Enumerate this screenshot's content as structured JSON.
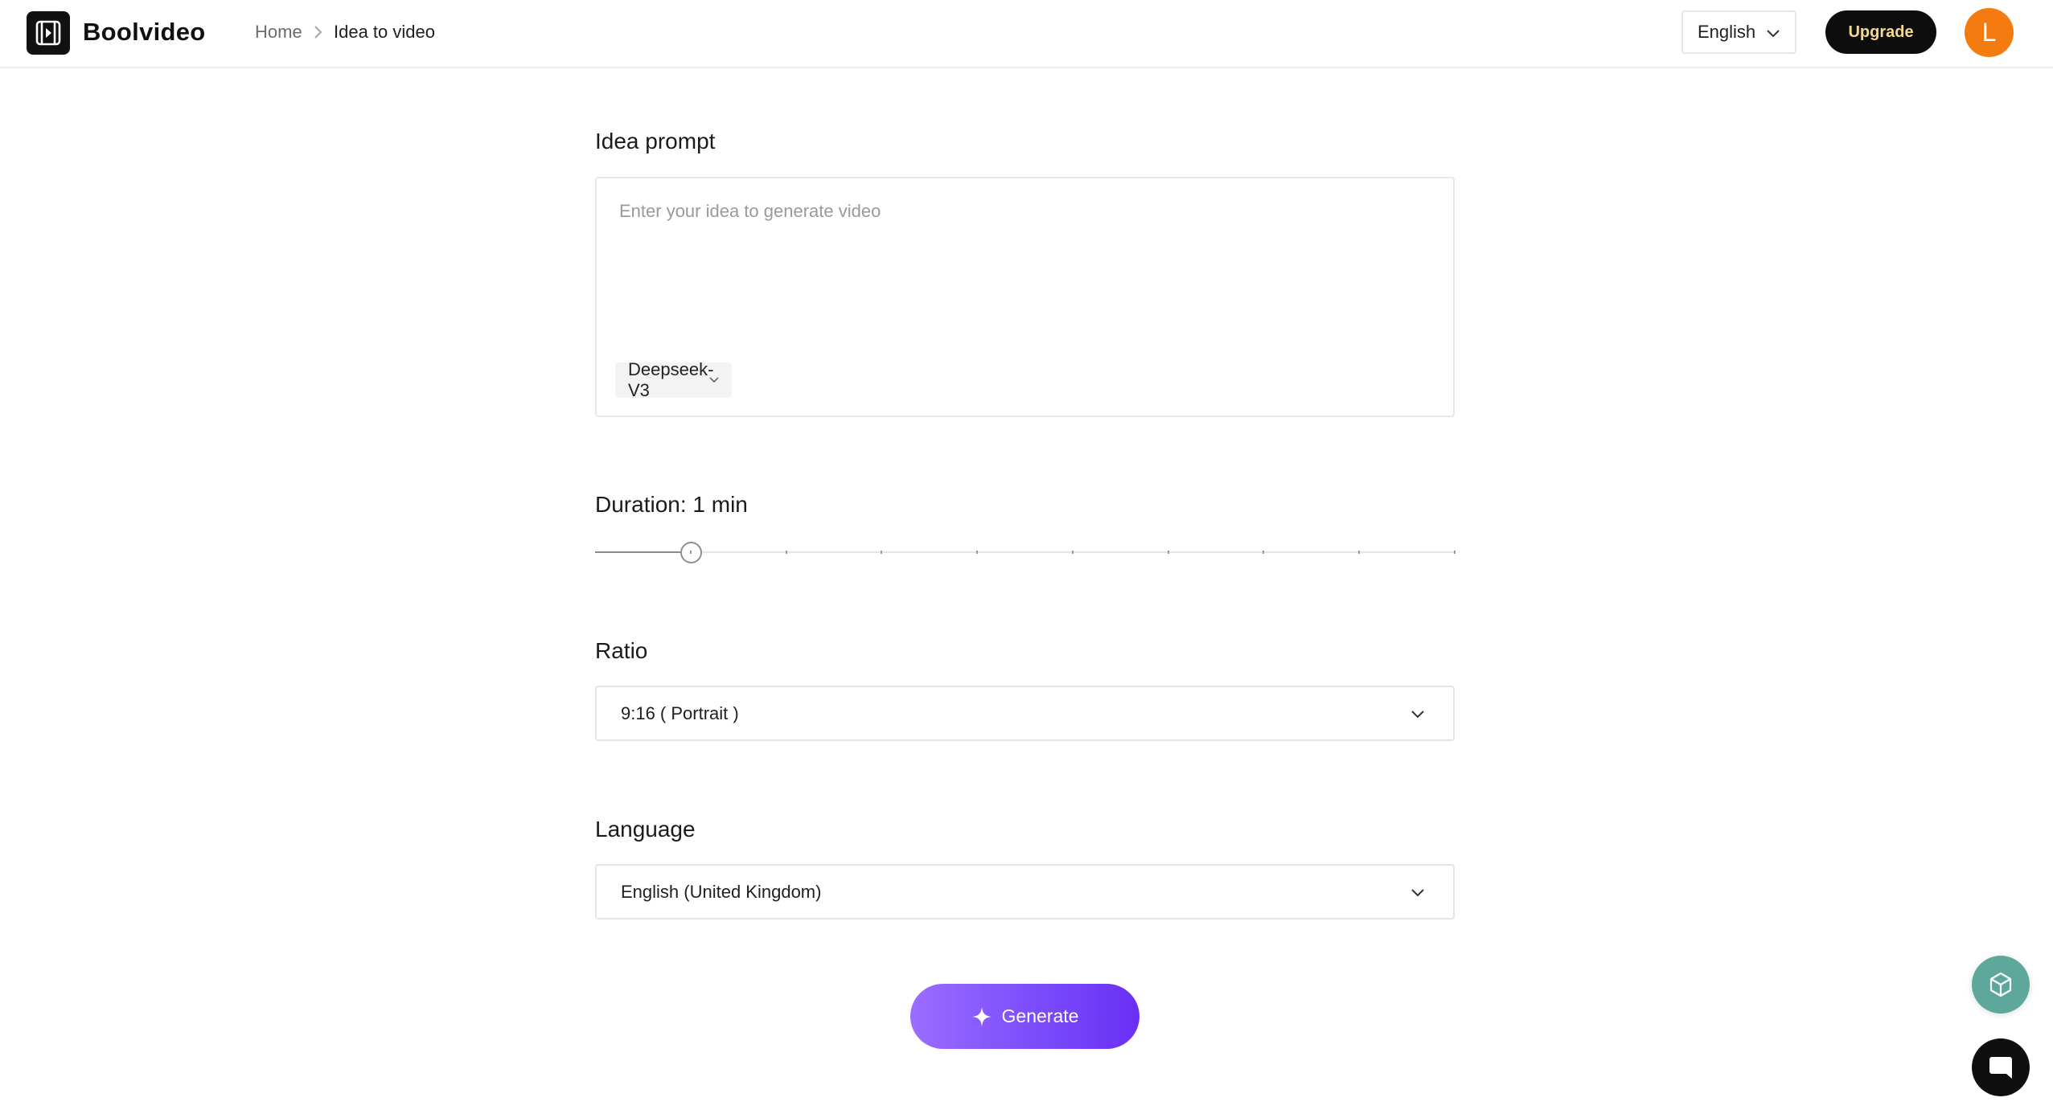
{
  "header": {
    "brand": "Boolvideo",
    "breadcrumb": {
      "home": "Home",
      "current": "Idea to video"
    },
    "language": "English",
    "upgrade_label": "Upgrade",
    "avatar_initial": "L"
  },
  "idea_prompt": {
    "label": "Idea prompt",
    "value": "",
    "placeholder": "Enter your idea to generate video",
    "model": "Deepseek-V3"
  },
  "duration": {
    "label": "Duration: 1 min",
    "value_minutes": 1,
    "min_minutes": 0,
    "max_minutes": 9,
    "level_fraction": 0.111
  },
  "ratio": {
    "label": "Ratio",
    "selected": "9:16 ( Portrait )"
  },
  "language_section": {
    "label": "Language",
    "selected": "English (United Kingdom)"
  },
  "generate_label": "Generate",
  "colors": {
    "accent_gradient_start": "#9b6dff",
    "accent_gradient_end": "#6a2ff5",
    "upgrade_bg": "#0d0d0d",
    "upgrade_text": "#f7d98a",
    "avatar_bg": "#f47b10",
    "assistant_fab": "#5ea79b",
    "chat_fab": "#0f0f0f"
  },
  "icons": {
    "logo": "film-play-icon",
    "breadcrumb_separator": "chevron-right-icon",
    "dropdown": "chevron-down-icon",
    "generate": "sparkle-icon",
    "assistant": "cube-icon",
    "chat": "chat-bubble-icon"
  }
}
